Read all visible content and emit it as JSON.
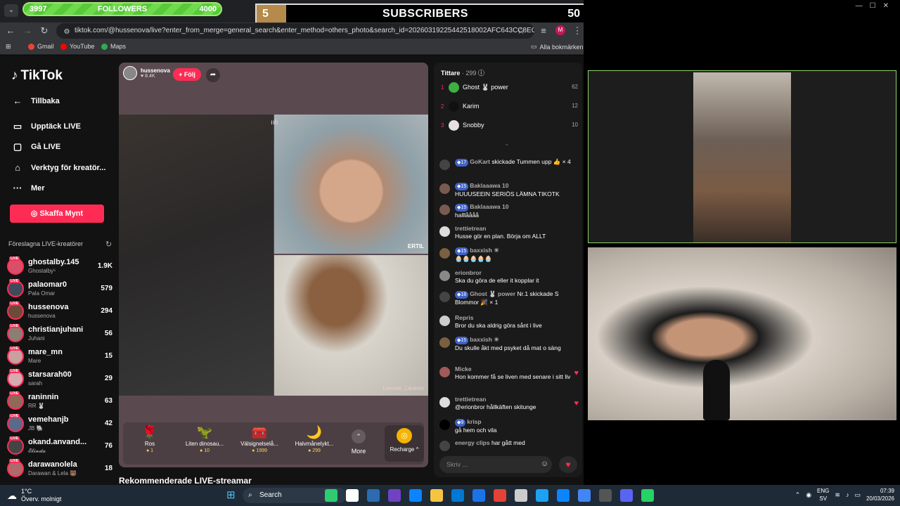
{
  "overlay": {
    "followers": {
      "current": "3997",
      "label": "FOLLOWERS",
      "goal": "4000"
    },
    "subscribers": {
      "count": "5",
      "label": "SUBSCRIBERS",
      "goal": "50"
    }
  },
  "browser": {
    "url": "tiktok.com/@hussenova/live?enter_from_merge=general_search&enter_method=others_photo&search_id=20260319225442518002AFC643CC8EC0E...",
    "bookmarks": [
      "Gmail",
      "YouTube",
      "Maps"
    ],
    "all_bookmarks": "Alla bokmärken"
  },
  "sidebar": {
    "logo": "TikTok",
    "items": [
      "Tillbaka",
      "Upptäck LIVE",
      "Gå LIVE",
      "Verktyg för kreatör...",
      "Mer"
    ],
    "coins_button": "Skaffa Mynt",
    "suggested_title": "Föreslagna LIVE-kreatörer",
    "creators": [
      {
        "name": "ghostalby.145",
        "sub": "Ghostalby⁵",
        "count": "1.9K"
      },
      {
        "name": "palaomar0",
        "sub": "Pala Omar",
        "count": "579"
      },
      {
        "name": "hussenova",
        "sub": "hussenova",
        "count": "294"
      },
      {
        "name": "christianjuhani",
        "sub": "Juhani",
        "count": "56"
      },
      {
        "name": "mare_mn",
        "sub": "Mare",
        "count": "15"
      },
      {
        "name": "starsarah00",
        "sub": "sarah",
        "count": "29"
      },
      {
        "name": "raninnin",
        "sub": "RR 🐰",
        "count": "63"
      },
      {
        "name": "vemehanjb",
        "sub": "JB 🐘",
        "count": "42"
      },
      {
        "name": "okand.anvand...",
        "sub": "𝓔𝓵𝓲𝓷𝓭𝓪",
        "count": "76"
      },
      {
        "name": "darawanolela",
        "sub": "Darawan & Lela 🐻",
        "count": "18"
      }
    ]
  },
  "live": {
    "host": "hussenova",
    "likes": "8.4K",
    "follow": "+ Följ",
    "tag_top": "ERTIL",
    "tag_bottom": "Leende_Läraren",
    "gifts": [
      {
        "name": "Ros",
        "price": "1",
        "icon": "🌹"
      },
      {
        "name": "Liten dinosau...",
        "price": "10",
        "icon": "🦖"
      },
      {
        "name": "Välsignelselå...",
        "price": "1999",
        "icon": "🧰"
      },
      {
        "name": "Halvmånelykt...",
        "price": "299",
        "icon": "🌙"
      }
    ],
    "more": "More",
    "recharge": "Recharge ^",
    "recommended": "Rekommenderade LIVE-streamar"
  },
  "chat": {
    "viewers_label": "Tittare",
    "viewers_count": "· 299",
    "top": [
      {
        "rank": "1",
        "name": "Ghost 🐰 power",
        "score": "62",
        "color": "#3cb043"
      },
      {
        "rank": "2",
        "name": "Karim",
        "score": "12",
        "color": "#111111"
      },
      {
        "rank": "3",
        "name": "Snobby",
        "score": "10",
        "color": "#e8e0e0"
      }
    ],
    "messages": [
      {
        "level": "17",
        "user": "GoKart",
        "text": "skickade Tummen upp 👍 × 4",
        "heart": false
      },
      {
        "level": "15",
        "user": "Baklaaawa 10",
        "text": "HUUUSEEIN SERIÖS LÄMNA TIKOTK",
        "heart": false
      },
      {
        "level": "15",
        "user": "Baklaaawa 10",
        "text": "halllåååå",
        "heart": false
      },
      {
        "level": "",
        "user": "trettietrean",
        "text": "Husse gör en plan. Börja om ALLT",
        "heart": false
      },
      {
        "level": "15",
        "user": "baxxish ☀",
        "text": "🧁🧁🧁🧁🧁",
        "heart": false
      },
      {
        "level": "",
        "user": "erionbror",
        "text": "Ska du göra de eller it kopplar it",
        "heart": false
      },
      {
        "level": "18",
        "user": "Ghost 🐰 power",
        "text": "Nr.1 skickade S Blommor 🎉 × 1",
        "heart": false
      },
      {
        "level": "",
        "user": "Repris",
        "text": "Bror du ska aldrig göra sånt i live",
        "heart": false
      },
      {
        "level": "15",
        "user": "baxxish ☀",
        "text": "Du skulle åkt med psyket då mat o säng",
        "heart": false
      },
      {
        "level": "",
        "user": "Micke",
        "text": "Hon kommer få se liven med senare i sitt liv",
        "heart": true
      },
      {
        "level": "",
        "user": "trettietrean",
        "text": "@erionbror hållkäften skitunge",
        "heart": true
      },
      {
        "level": "9",
        "user": "krisp",
        "text": "gå hem och vila",
        "heart": false
      },
      {
        "level": "",
        "user": "energy clips",
        "text": "har gått med",
        "heart": false
      }
    ],
    "input_placeholder": "Skriv ..."
  },
  "taskbar": {
    "temp": "1°C",
    "weather": "Överv. molnigt",
    "search": "Search",
    "lang": "ENG",
    "region": "SV",
    "time": "07:39",
    "date": "20/03/2026"
  }
}
